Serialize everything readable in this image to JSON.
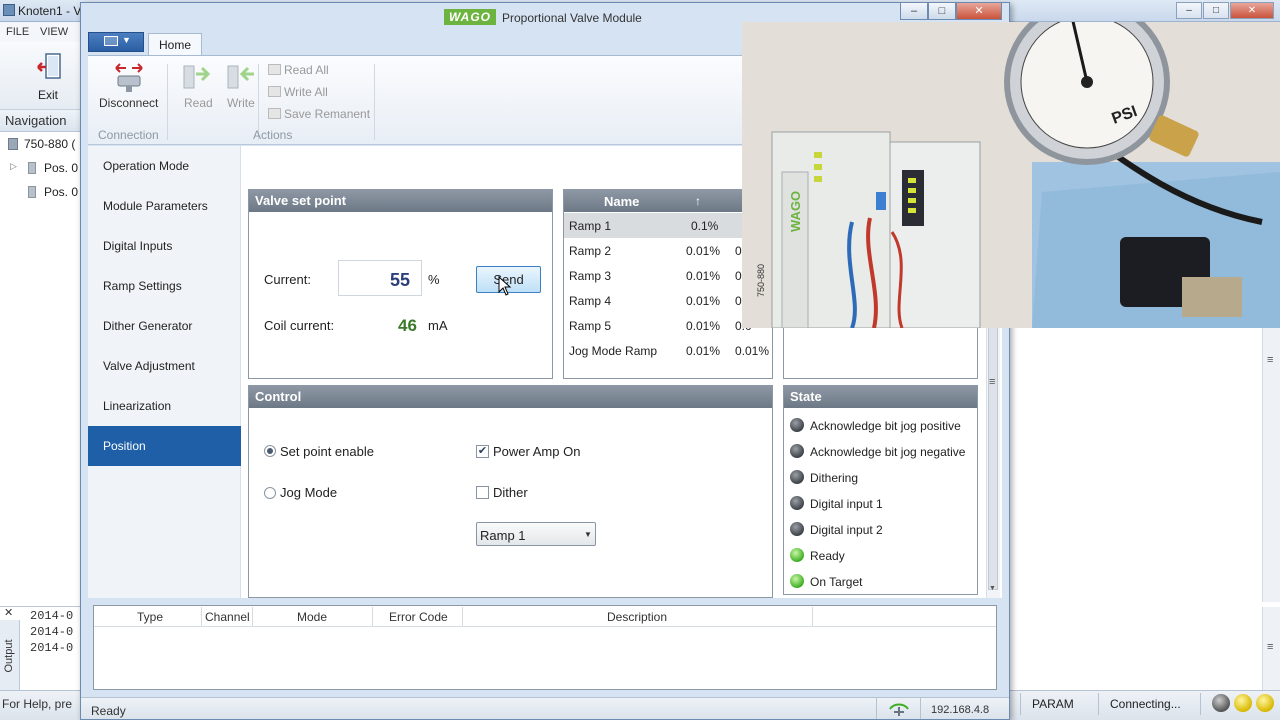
{
  "background_app": {
    "title": "Knoten1 - V",
    "menu": [
      "FILE",
      "VIEW"
    ],
    "exit_label": "Exit",
    "navigation_title": "Navigation",
    "nav_items": [
      "750-880 (",
      "Pos. 0",
      "Pos. 0"
    ],
    "output_label": "Output",
    "log_lines": [
      "2014-0",
      "2014-0",
      "2014-0"
    ],
    "help_text": "For Help, pre",
    "param_label": "PARAM",
    "connecting_label": "Connecting...",
    "window_controls": [
      "–",
      "□",
      "✕"
    ]
  },
  "dialog": {
    "title": "Proportional Valve Module",
    "logo": "WAGO",
    "window_controls": [
      "–",
      "□",
      "✕"
    ],
    "tab_home": "Home",
    "ribbon": {
      "disconnect": "Disconnect",
      "read": "Read",
      "write": "Write",
      "read_all": "Read All",
      "write_all": "Write All",
      "save_remanent": "Save Remanent",
      "group_connection": "Connection",
      "group_actions": "Actions"
    },
    "side_nav": [
      "Operation Mode",
      "Module Parameters",
      "Digital Inputs",
      "Ramp Settings",
      "Dither Generator",
      "Valve Adjustment",
      "Linearization",
      "Position"
    ],
    "active_side_item": "Position",
    "valve_set_point": {
      "title": "Valve set point",
      "current_label": "Current:",
      "current_value": "55",
      "current_unit": "%",
      "send_label": "Send",
      "coil_label": "Coil current:",
      "coil_value": "46",
      "coil_unit": "mA"
    },
    "ramp_table": {
      "col_name": "Name",
      "sort_icon": "↑",
      "rows": [
        {
          "name": "Ramp 1",
          "v1": "0.1%",
          "v2": ""
        },
        {
          "name": "Ramp 2",
          "v1": "0.01%",
          "v2": "0"
        },
        {
          "name": "Ramp 3",
          "v1": "0.01%",
          "v2": "0"
        },
        {
          "name": "Ramp 4",
          "v1": "0.01%",
          "v2": "0"
        },
        {
          "name": "Ramp 5",
          "v1": "0.01%",
          "v2": "0.0"
        },
        {
          "name": "Jog Mode Ramp",
          "v1": "0.01%",
          "v2": "0.01%"
        }
      ]
    },
    "control": {
      "title": "Control",
      "set_point_enable": "Set point enable",
      "jog_mode": "Jog Mode",
      "power_amp_on": "Power Amp On",
      "dither": "Dither",
      "ramp_select": "Ramp 1"
    },
    "state": {
      "title": "State",
      "items": [
        {
          "label": "Acknowledge bit jog positive",
          "on": false
        },
        {
          "label": "Acknowledge bit jog negative",
          "on": false
        },
        {
          "label": "Dithering",
          "on": false
        },
        {
          "label": "Digital input 1",
          "on": false
        },
        {
          "label": "Digital input 2",
          "on": false
        },
        {
          "label": "Ready",
          "on": true
        },
        {
          "label": "On Target",
          "on": true
        }
      ]
    },
    "error_grid": {
      "columns": [
        "Type",
        "Channel",
        "Mode",
        "Error Code",
        "Description"
      ]
    },
    "status_text": "Ready",
    "ip": "192.168.4.8"
  },
  "video_overlay": {
    "device_label": "750-880",
    "gauge_unit": "PSI"
  },
  "colors": {
    "accent": "#1e5fa8",
    "led_on": "#3fae24",
    "led_off": "#3d4248",
    "panel_header": "#7a8593"
  }
}
